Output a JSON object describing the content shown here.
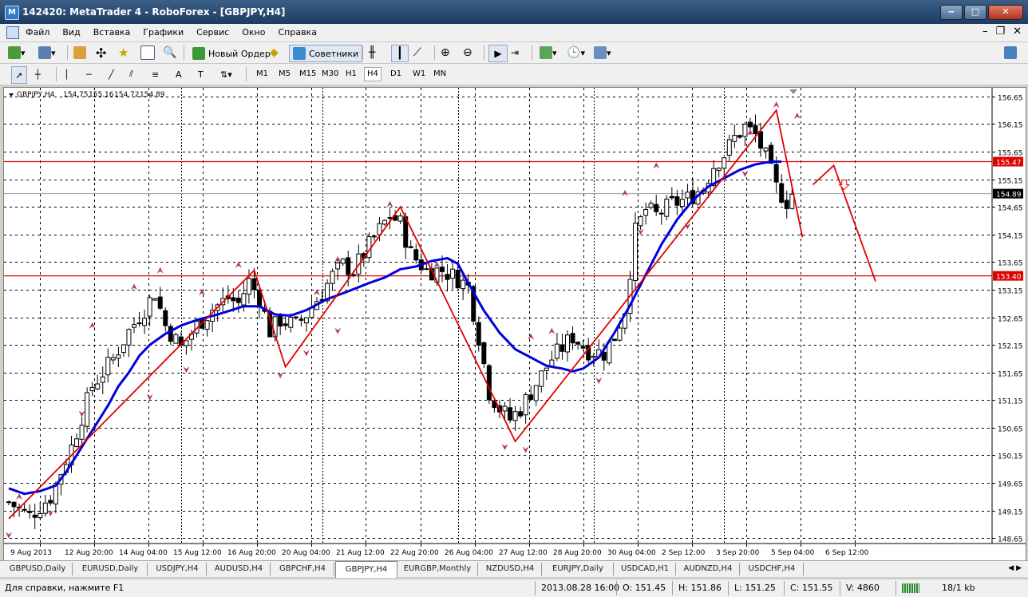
{
  "window": {
    "title": "142420: MetaTrader 4 - RoboForex - [GBPJPY,H4]"
  },
  "menu": [
    "Файл",
    "Вид",
    "Вставка",
    "Графики",
    "Сервис",
    "Окно",
    "Справка"
  ],
  "toolbar": {
    "new_order": "Новый Ордер",
    "experts": "Советники"
  },
  "timeframes": [
    "M1",
    "M5",
    "M15",
    "M30",
    "H1",
    "H4",
    "D1",
    "W1",
    "MN"
  ],
  "active_timeframe": "H4",
  "chart_header": {
    "symbol": "GBPJPY,H4",
    "open": "154.75",
    "high": "155.16",
    "low": "154.72",
    "close": "154.89"
  },
  "tabs": [
    "GBPUSD,Daily",
    "EURUSD,Daily",
    "USDJPY,H4",
    "AUDUSD,H4",
    "GBPCHF,H4",
    "GBPJPY,H4",
    "EURGBP,Monthly",
    "NZDUSD,H4",
    "EURJPY,Daily",
    "USDCAD,H1",
    "AUDNZD,H4",
    "USDCHF,H4"
  ],
  "active_tab": "GBPJPY,H4",
  "status": {
    "help": "Для справки, нажмите F1",
    "datetime": "2013.08.28 16:00",
    "o": "O: 151.45",
    "h": "H: 151.86",
    "l": "L: 151.25",
    "c": "C: 151.55",
    "v": "V: 4860",
    "traffic": "18/1 kb"
  },
  "colors": {
    "bg": "#ffffff",
    "grid": "#000000",
    "zigzag": "#e00000",
    "ma": "#0000dd",
    "level_line": "#e00000",
    "bar": "#000000",
    "fractal": "#b03a6a",
    "current_price_label": "#000000",
    "level_label": "#e00000"
  },
  "chart_data": {
    "type": "candlestick",
    "symbol": "GBPJPY",
    "timeframe": "H4",
    "y_ticks": [
      156.65,
      156.15,
      155.65,
      155.15,
      154.65,
      154.15,
      153.65,
      153.15,
      152.65,
      152.15,
      151.65,
      151.15,
      150.65,
      150.15,
      149.65,
      149.15,
      148.65
    ],
    "ylim": [
      148.55,
      156.75
    ],
    "x_ticks": [
      "9 Aug 2013",
      "12 Aug 20:00",
      "14 Aug 04:00",
      "15 Aug 12:00",
      "16 Aug 20:00",
      "20 Aug 04:00",
      "21 Aug 12:00",
      "22 Aug 20:00",
      "26 Aug 04:00",
      "27 Aug 12:00",
      "28 Aug 20:00",
      "30 Aug 04:00",
      "2 Sep 12:00",
      "3 Sep 20:00",
      "5 Sep 04:00",
      "6 Sep 12:00"
    ],
    "x_range_bars": [
      0,
      155
    ],
    "current_price": 154.89,
    "horizontal_levels": [
      155.47,
      153.4
    ],
    "close_path": [
      [
        0,
        149.3
      ],
      [
        4,
        149.05
      ],
      [
        8,
        149.4
      ],
      [
        12,
        150.3
      ],
      [
        16,
        151.4
      ],
      [
        20,
        151.9
      ],
      [
        23,
        152.4
      ],
      [
        26,
        152.8
      ],
      [
        28,
        153.1
      ],
      [
        30,
        152.5
      ],
      [
        33,
        152.1
      ],
      [
        36,
        152.5
      ],
      [
        39,
        152.8
      ],
      [
        42,
        153.0
      ],
      [
        44,
        152.9
      ],
      [
        46,
        153.3
      ],
      [
        48,
        153.0
      ],
      [
        50,
        152.4
      ],
      [
        52,
        152.6
      ],
      [
        55,
        152.5
      ],
      [
        57,
        152.7
      ],
      [
        60,
        153.1
      ],
      [
        62,
        153.4
      ],
      [
        64,
        153.6
      ],
      [
        66,
        153.5
      ],
      [
        70,
        154.1
      ],
      [
        73,
        154.5
      ],
      [
        75,
        154.35
      ],
      [
        77,
        153.8
      ],
      [
        80,
        153.5
      ],
      [
        83,
        153.5
      ],
      [
        86,
        153.35
      ],
      [
        88,
        153.2
      ],
      [
        90,
        152.3
      ],
      [
        92,
        151.3
      ],
      [
        94,
        151.0
      ],
      [
        96,
        150.8
      ],
      [
        98,
        151.0
      ],
      [
        100,
        151.3
      ],
      [
        102,
        151.6
      ],
      [
        104,
        151.9
      ],
      [
        106,
        152.1
      ],
      [
        108,
        152.3
      ],
      [
        111,
        152.05
      ],
      [
        114,
        152.0
      ],
      [
        116,
        152.3
      ],
      [
        118,
        152.8
      ],
      [
        120,
        154.2
      ],
      [
        122,
        154.6
      ],
      [
        124,
        154.5
      ],
      [
        127,
        154.7
      ],
      [
        130,
        154.8
      ],
      [
        133,
        155.0
      ],
      [
        135,
        155.4
      ],
      [
        137,
        155.6
      ],
      [
        139,
        155.9
      ],
      [
        141,
        156.1
      ],
      [
        143,
        155.95
      ],
      [
        145,
        155.55
      ],
      [
        147,
        155.0
      ],
      [
        149,
        154.75
      ],
      [
        150,
        154.89
      ]
    ],
    "moving_average": [
      [
        0,
        149.55
      ],
      [
        3,
        149.45
      ],
      [
        6,
        149.5
      ],
      [
        9,
        149.6
      ],
      [
        11,
        149.85
      ],
      [
        14,
        150.3
      ],
      [
        17,
        150.75
      ],
      [
        19,
        151.05
      ],
      [
        21,
        151.4
      ],
      [
        23,
        151.65
      ],
      [
        25,
        151.95
      ],
      [
        27,
        152.15
      ],
      [
        30,
        152.35
      ],
      [
        33,
        152.5
      ],
      [
        36,
        152.6
      ],
      [
        40,
        152.7
      ],
      [
        45,
        152.85
      ],
      [
        48,
        152.85
      ],
      [
        51,
        152.7
      ],
      [
        54,
        152.68
      ],
      [
        57,
        152.78
      ],
      [
        61,
        152.98
      ],
      [
        65,
        153.12
      ],
      [
        69,
        153.27
      ],
      [
        72,
        153.37
      ],
      [
        75,
        153.52
      ],
      [
        78,
        153.57
      ],
      [
        81,
        153.67
      ],
      [
        84,
        153.72
      ],
      [
        86,
        153.62
      ],
      [
        88,
        153.27
      ],
      [
        91,
        152.77
      ],
      [
        94,
        152.37
      ],
      [
        97,
        152.07
      ],
      [
        100,
        151.92
      ],
      [
        103,
        151.77
      ],
      [
        106,
        151.72
      ],
      [
        108,
        151.67
      ],
      [
        110,
        151.72
      ],
      [
        113,
        151.92
      ],
      [
        116,
        152.37
      ],
      [
        119,
        152.87
      ],
      [
        122,
        153.42
      ],
      [
        125,
        153.97
      ],
      [
        128,
        154.42
      ],
      [
        131,
        154.77
      ],
      [
        134,
        155.02
      ],
      [
        137,
        155.17
      ],
      [
        140,
        155.32
      ],
      [
        143,
        155.42
      ],
      [
        146,
        155.47
      ],
      [
        148,
        155.47
      ]
    ],
    "zigzag": [
      [
        0,
        149.0
      ],
      [
        47,
        153.5
      ],
      [
        53,
        151.75
      ],
      [
        75,
        154.65
      ],
      [
        81,
        153.5
      ],
      [
        97,
        150.4
      ],
      [
        147,
        156.4
      ],
      [
        152,
        154.1
      ]
    ],
    "projection": [
      [
        154,
        155.05
      ],
      [
        158,
        155.4
      ],
      [
        166,
        153.3
      ]
    ],
    "fractals_up": [
      [
        2,
        149.4
      ],
      [
        16,
        152.5
      ],
      [
        24,
        153.2
      ],
      [
        29,
        153.5
      ],
      [
        37,
        153.1
      ],
      [
        44,
        153.6
      ],
      [
        59,
        153.1
      ],
      [
        63,
        153.7
      ],
      [
        73,
        154.7
      ],
      [
        82,
        153.6
      ],
      [
        100,
        152.3
      ],
      [
        104,
        152.4
      ],
      [
        118,
        154.9
      ],
      [
        124,
        155.4
      ],
      [
        142,
        156.0
      ],
      [
        147,
        156.5
      ],
      [
        151,
        156.3
      ]
    ],
    "fractals_down": [
      [
        0,
        148.7
      ],
      [
        8,
        149.1
      ],
      [
        14,
        150.9
      ],
      [
        27,
        151.2
      ],
      [
        34,
        151.7
      ],
      [
        52,
        151.6
      ],
      [
        57,
        152.0
      ],
      [
        63,
        152.4
      ],
      [
        95,
        150.3
      ],
      [
        99,
        150.25
      ],
      [
        113,
        151.5
      ],
      [
        121,
        154.2
      ],
      [
        130,
        154.3
      ],
      [
        141,
        155.25
      ]
    ],
    "down_arrow": [
      [
        160,
        155.05
      ]
    ]
  }
}
